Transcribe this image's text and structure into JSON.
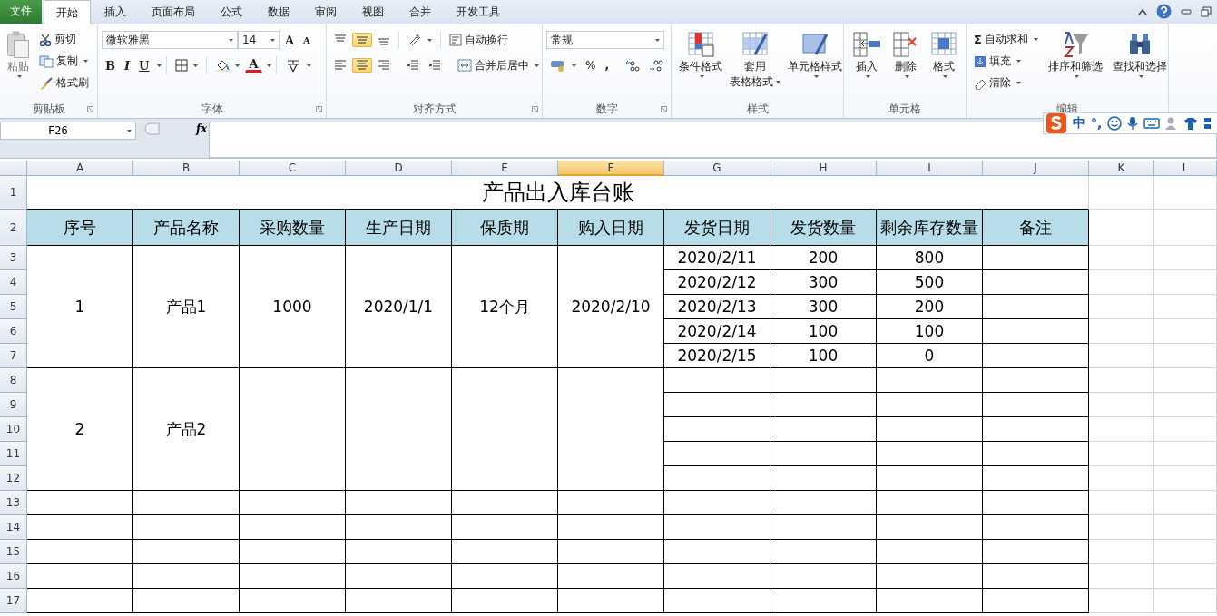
{
  "menu_tabs": [
    {
      "kind": "file",
      "label": "文件",
      "selected": false
    },
    {
      "kind": "tab",
      "label": "开始",
      "selected": true
    },
    {
      "kind": "tab",
      "label": "插入",
      "selected": false
    },
    {
      "kind": "tab",
      "label": "页面布局",
      "selected": false
    },
    {
      "kind": "tab",
      "label": "公式",
      "selected": false
    },
    {
      "kind": "tab",
      "label": "数据",
      "selected": false
    },
    {
      "kind": "tab",
      "label": "审阅",
      "selected": false
    },
    {
      "kind": "tab",
      "label": "视图",
      "selected": false
    },
    {
      "kind": "tab",
      "label": "合并",
      "selected": false
    },
    {
      "kind": "tab",
      "label": "开发工具",
      "selected": false
    }
  ],
  "ribbon": {
    "clipboard": {
      "paste": "粘贴",
      "cut": "剪切",
      "copy": "复制",
      "format_painter": "格式刷",
      "title": "剪贴板"
    },
    "font": {
      "name": "微软雅黑",
      "size": "14",
      "grow": "A",
      "shrink": "A",
      "bold": "B",
      "italic": "I",
      "underline": "U",
      "font_color": "A",
      "title": "字体"
    },
    "alignment": {
      "vertical": [
        {
          "selected": false
        },
        {
          "selected": true
        },
        {
          "selected": false
        }
      ],
      "horizontal": [
        {
          "selected": false
        },
        {
          "selected": true
        },
        {
          "selected": false
        }
      ],
      "wrap_text": "自动换行",
      "merge_center": "合并后居中",
      "title": "对齐方式"
    },
    "number": {
      "format": "常规",
      "percent": "%",
      "comma": ",",
      "title": "数字"
    },
    "styles": {
      "conditional": "条件格式",
      "table_format": [
        "套用",
        "表格格式"
      ],
      "cell_styles": "单元格样式",
      "title": "样式"
    },
    "cells": {
      "insert": "插入",
      "delete": "删除",
      "format": "格式",
      "title": "单元格"
    },
    "editing": {
      "sum_symbol": "Σ",
      "autosum": "自动求和",
      "fill": "填充",
      "clear": "清除",
      "sort_filter": "排序和筛选",
      "find_select": "查找和选择",
      "title": "编辑"
    }
  },
  "formula_bar": {
    "name_box": "F26",
    "fx": "fx"
  },
  "ime_bar": {
    "mode": "中",
    "punctuation": "°,"
  },
  "sheet": {
    "columns": [
      {
        "label": "A",
        "selected": false
      },
      {
        "label": "B",
        "selected": false
      },
      {
        "label": "C",
        "selected": false
      },
      {
        "label": "D",
        "selected": false
      },
      {
        "label": "E",
        "selected": false
      },
      {
        "label": "F",
        "selected": true
      },
      {
        "label": "G",
        "selected": false
      },
      {
        "label": "H",
        "selected": false
      },
      {
        "label": "I",
        "selected": false
      },
      {
        "label": "J",
        "selected": false
      },
      {
        "label": "K",
        "selected": false
      },
      {
        "label": "L",
        "selected": false
      }
    ],
    "rows": [
      "1",
      "2",
      "3",
      "4",
      "5",
      "6",
      "7",
      "8",
      "9",
      "10",
      "11",
      "12",
      "13",
      "14",
      "15",
      "16",
      "17"
    ],
    "title": "产品出入库台账",
    "headers": [
      "序号",
      "产品名称",
      "采购数量",
      "生产日期",
      "保质期",
      "购入日期",
      "发货日期",
      "发货数量",
      "剩余库存数量",
      "备注"
    ],
    "products": [
      {
        "no": "1",
        "name": "产品1",
        "quantity": "1000",
        "production_date": "2020/1/1",
        "shelf_life": "12个月",
        "purchase_date": "2020/2/10",
        "shipments": [
          {
            "date": "2020/2/11",
            "quantity": "200",
            "remaining": "800"
          },
          {
            "date": "2020/2/12",
            "quantity": "300",
            "remaining": "500"
          },
          {
            "date": "2020/2/13",
            "quantity": "300",
            "remaining": "200"
          },
          {
            "date": "2020/2/14",
            "quantity": "100",
            "remaining": "100"
          },
          {
            "date": "2020/2/15",
            "quantity": "100",
            "remaining": "0"
          }
        ]
      },
      {
        "no": "2",
        "name": "产品2"
      }
    ]
  }
}
